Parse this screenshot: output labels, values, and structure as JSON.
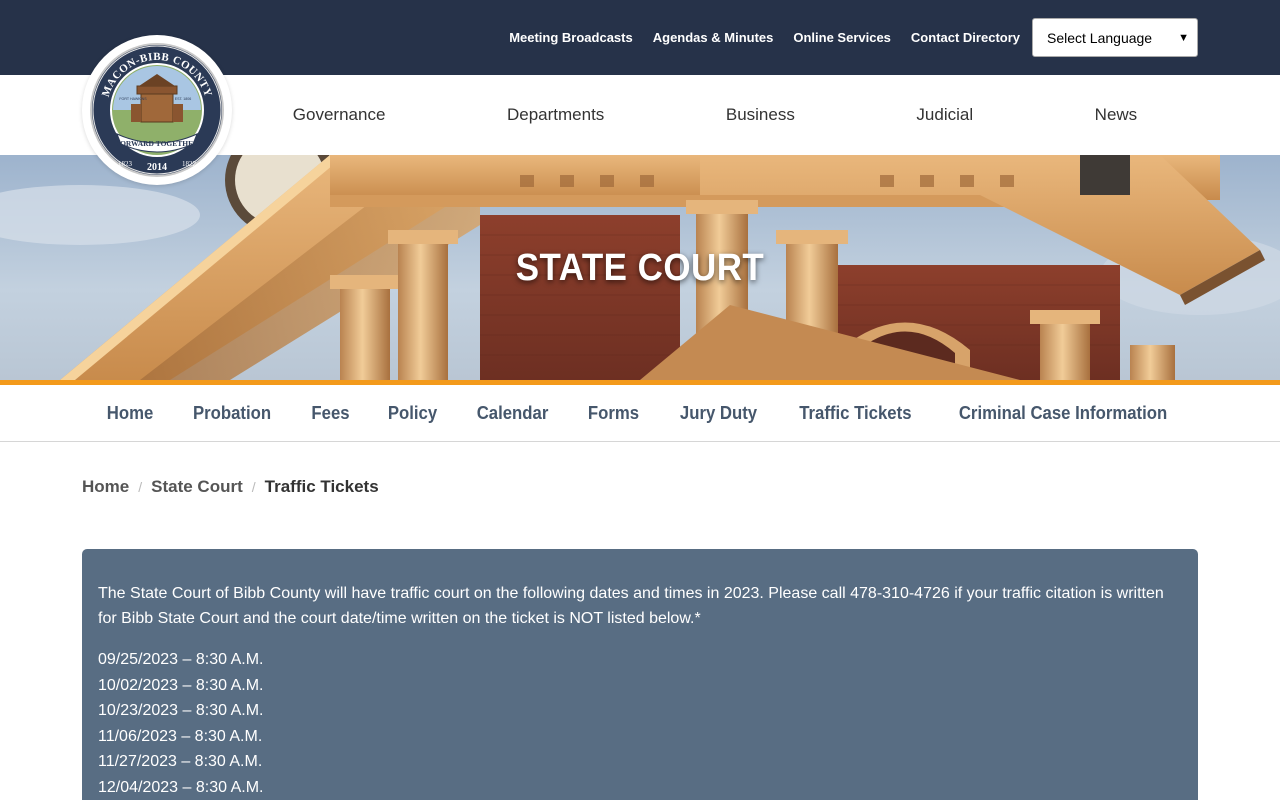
{
  "utility": {
    "links": [
      "Meeting Broadcasts",
      "Agendas & Minutes",
      "Online Services",
      "Contact Directory"
    ],
    "language_select": "Select Language"
  },
  "logo": {
    "top_text": "MACON-BIBB COUNTY",
    "banner_text": "FORWARD TOGETHER",
    "years_left": "1823",
    "year_center": "2014",
    "years_right": "1822",
    "fort_left": "FORT HAWKINS",
    "fort_right": "EST. 1806"
  },
  "main_nav": [
    "Governance",
    "Departments",
    "Business",
    "Judicial",
    "News"
  ],
  "hero": {
    "title": "STATE COURT"
  },
  "sub_nav": [
    "Home",
    "Probation",
    "Fees",
    "Policy",
    "Calendar",
    "Forms",
    "Jury Duty",
    "Traffic Tickets",
    "Criminal Case Information"
  ],
  "breadcrumb": {
    "home": "Home",
    "section": "State Court",
    "current": "Traffic Tickets",
    "separator": "/"
  },
  "content": {
    "intro": "The State Court of Bibb County will have traffic court on the following dates and times in 2023. Please call 478-310-4726 if your traffic citation is written for Bibb State Court and the court date/time written on the ticket is NOT listed below.*",
    "dates": [
      "09/25/2023 – 8:30 A.M.",
      "10/02/2023 – 8:30 A.M.",
      "10/23/2023 – 8:30 A.M.",
      "11/06/2023 – 8:30 A.M.",
      "11/27/2023 – 8:30 A.M.",
      "12/04/2023 – 8:30 A.M."
    ]
  },
  "colors": {
    "utility_bg": "#263249",
    "accent_orange": "#f39a1b",
    "panel_bg": "#586d83",
    "subnav_text": "#46576c"
  }
}
